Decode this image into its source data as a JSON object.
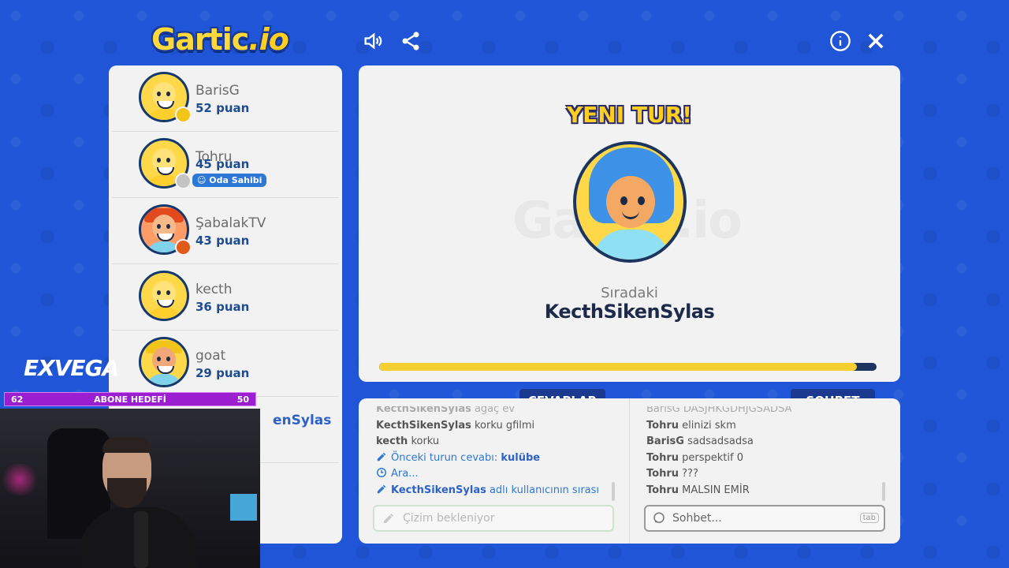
{
  "header": {
    "logo_main": "Gartic",
    "logo_suffix": ".io",
    "sound_icon": "speaker-icon",
    "share_icon": "share-icon",
    "info_icon": "info-icon",
    "close_icon": "close-icon"
  },
  "players": [
    {
      "name": "BarisG",
      "score": "52 puan",
      "status_color": "#f2c518",
      "avatar": "default"
    },
    {
      "name": "Tohru",
      "score": "45 puan",
      "status_color": "#c4c4c4",
      "avatar": "default",
      "badge": "Oda Sahibi"
    },
    {
      "name": "ŞabalakTV",
      "score": "43 puan",
      "status_color": "#e05a1c",
      "avatar": "red"
    },
    {
      "name": "kecth",
      "score": "36 puan",
      "avatar": "default"
    },
    {
      "name": "goat",
      "score": "29 puan",
      "avatar": "cap"
    },
    {
      "name": "enSylas",
      "avatar": "partial"
    }
  ],
  "main": {
    "round_title": "YENI TUR!",
    "watermark": "Gartic.io",
    "next_label": "Sıradaki",
    "next_name": "KecthSikenSylas",
    "progress": 0.96,
    "progress_color": "#f6cf33"
  },
  "tabs": {
    "answers": "CEVAPLAR",
    "chat": "SOHBET"
  },
  "answers": {
    "lines": [
      {
        "user": "KecthSikenSylas",
        "text": "ağaç ev",
        "dim": true
      },
      {
        "user": "KecthSikenSylas",
        "text": "korku gfilmi"
      },
      {
        "user": "kecth",
        "text": "korku"
      }
    ],
    "system": {
      "prev_answer_label": "Önceki turun cevabı:",
      "prev_answer": "kulübe",
      "searching": "Ara...",
      "turn_user": "KecthSikenSylas",
      "turn_text": "adlı kullanıcının sırası"
    },
    "input_placeholder": "Çizim bekleniyor"
  },
  "chat": {
    "lines": [
      {
        "user": "BarisG",
        "text": "DASJHKGDHJGSADSA",
        "dim": true
      },
      {
        "user": "Tohru",
        "text": "elinizi skm"
      },
      {
        "user": "BarisG",
        "text": "sadsadsadsa"
      },
      {
        "user": "Tohru",
        "text": "perspektif 0"
      },
      {
        "user": "Tohru",
        "text": "???"
      },
      {
        "user": "Tohru",
        "text": "MALSIN EMİR"
      }
    ],
    "input_placeholder": "Sohbet...",
    "tab_key": "tab"
  },
  "overlay": {
    "brand": "EXVEGA",
    "goal_left": "62",
    "goal_label": "ABONE HEDEFİ",
    "goal_right": "50"
  },
  "colors": {
    "background": "#1f55d6",
    "accent_blue": "#1b3a8f",
    "yellow": "#ffcf1f"
  }
}
